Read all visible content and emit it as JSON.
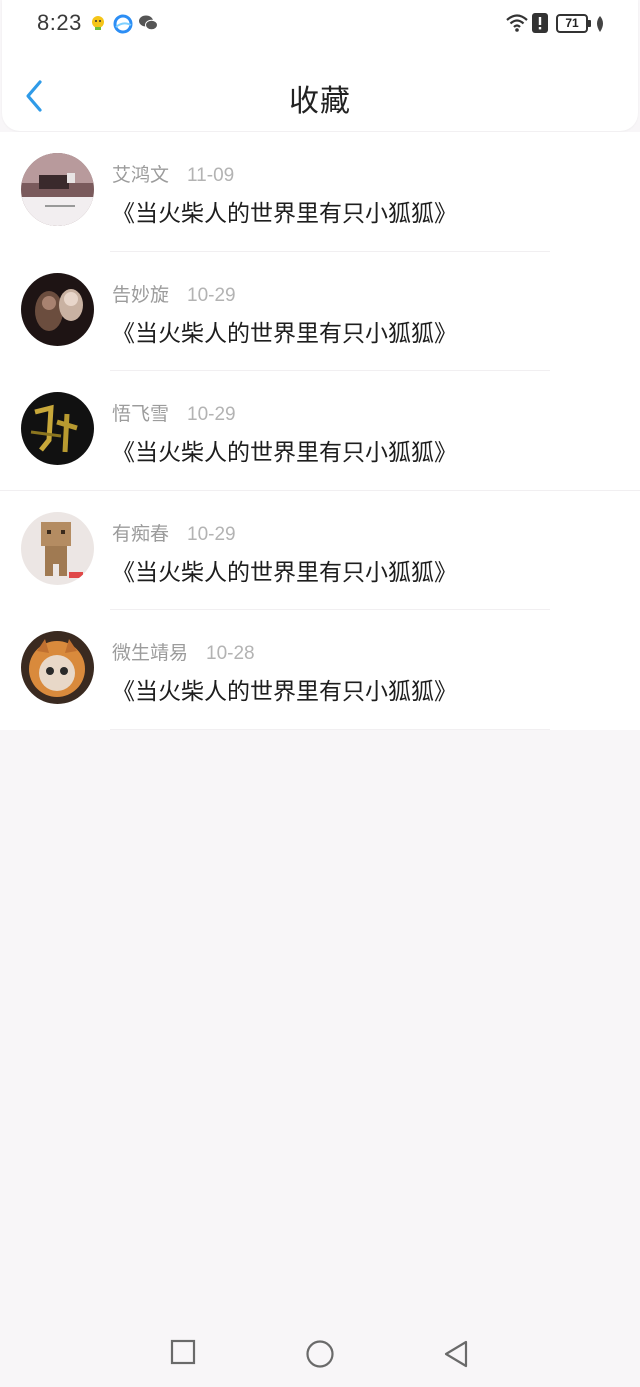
{
  "status_bar": {
    "time": "8:23",
    "battery": "71"
  },
  "header": {
    "title": "收藏"
  },
  "favorites": [
    {
      "author": "艾鸿文",
      "date": "11-09",
      "title": "《当火柴人的世界里有只小狐狐》"
    },
    {
      "author": "告妙旋",
      "date": "10-29",
      "title": "《当火柴人的世界里有只小狐狐》"
    },
    {
      "author": "悟飞雪",
      "date": "10-29",
      "title": "《当火柴人的世界里有只小狐狐》"
    },
    {
      "author": "有痴春",
      "date": "10-29",
      "title": "《当火柴人的世界里有只小狐狐》"
    },
    {
      "author": "微生靖易",
      "date": "10-28",
      "title": "《当火柴人的世界里有只小狐狐》"
    }
  ],
  "colors": {
    "accent": "#2f9be8",
    "background": "#f8f6f8"
  }
}
